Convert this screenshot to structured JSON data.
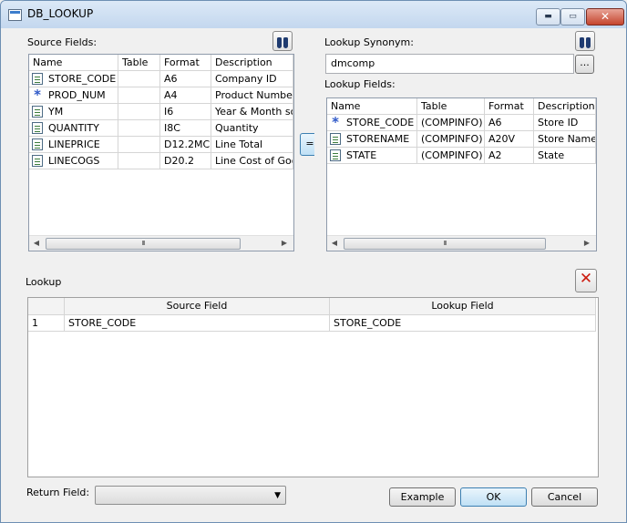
{
  "window": {
    "title": "DB_LOOKUP",
    "min_glyph": "▬",
    "max_glyph": "▭",
    "close_glyph": "✕"
  },
  "source": {
    "label": "Source Fields:",
    "columns": [
      "Name",
      "Table",
      "Format",
      "Description"
    ],
    "rows": [
      {
        "icon": "field-icon",
        "name": "STORE_CODE",
        "table": "",
        "format": "A6",
        "description": "Company ID"
      },
      {
        "icon": "key-icon",
        "name": "PROD_NUM",
        "table": "",
        "format": "A4",
        "description": "Product Number"
      },
      {
        "icon": "field-icon",
        "name": "YM",
        "table": "",
        "format": "I6",
        "description": "Year & Month sold"
      },
      {
        "icon": "field-icon",
        "name": "QUANTITY",
        "table": "",
        "format": "I8C",
        "description": "Quantity"
      },
      {
        "icon": "field-icon",
        "name": "LINEPRICE",
        "table": "",
        "format": "D12.2MC",
        "description": "Line Total"
      },
      {
        "icon": "field-icon",
        "name": "LINECOGS",
        "table": "",
        "format": "D20.2",
        "description": "Line Cost of Goods"
      }
    ],
    "scroll_grip": "III"
  },
  "match_button": {
    "label": "="
  },
  "lookup_synonym": {
    "label": "Lookup Synonym:",
    "value": "dmcomp",
    "browse_label": "..."
  },
  "lookup_fields": {
    "label": "Lookup Fields:",
    "columns": [
      "Name",
      "Table",
      "Format",
      "Description"
    ],
    "rows": [
      {
        "icon": "key-icon",
        "name": "STORE_CODE",
        "table": "(COMPINFO)",
        "format": "A6",
        "description": "Store ID"
      },
      {
        "icon": "field-icon",
        "name": "STORENAME",
        "table": "(COMPINFO)",
        "format": "A20V",
        "description": "Store Name"
      },
      {
        "icon": "field-icon",
        "name": "STATE",
        "table": "(COMPINFO)",
        "format": "A2",
        "description": "State"
      }
    ],
    "scroll_grip": "III"
  },
  "lookup": {
    "label": "Lookup",
    "columns": [
      "Source Field",
      "Lookup Field"
    ],
    "rows": [
      {
        "num": "1",
        "source": "STORE_CODE",
        "lookup": "STORE_CODE"
      }
    ]
  },
  "return_field": {
    "label": "Return Field:",
    "value": ""
  },
  "buttons": {
    "example": "Example",
    "ok": "OK",
    "cancel": "Cancel"
  },
  "colors": {
    "key_icon": "#2f59c8",
    "delete_icon": "#cc1c10"
  }
}
